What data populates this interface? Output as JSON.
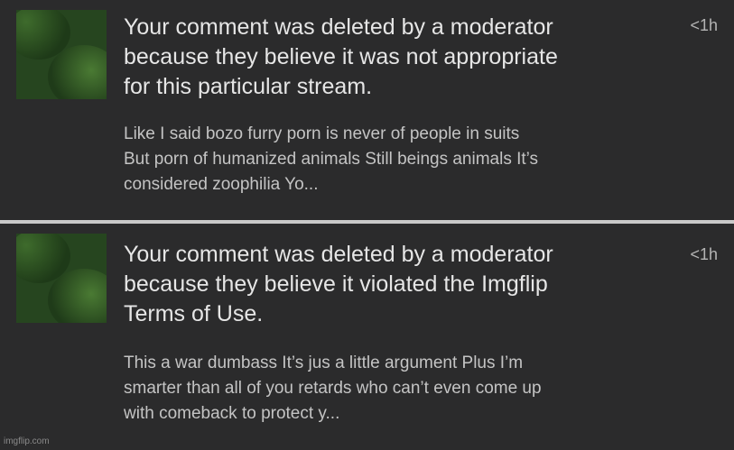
{
  "notifications": [
    {
      "headline_lines": [
        "Your comment was deleted by a moderator",
        "because they believe it was not appropriate",
        "for this particular stream."
      ],
      "time": "<1h",
      "comment_lines": [
        "Like I said bozo furry porn is never of people in suits",
        "But porn of humanized animals Still beings animals It’s",
        "considered zoophilia Yo..."
      ]
    },
    {
      "headline_lines": [
        "Your comment was deleted by a moderator",
        "because they believe it violated the Imgflip",
        "Terms of Use."
      ],
      "time": "<1h",
      "comment_lines": [
        "This a war dumbass It’s jus a little argument Plus I’m",
        "smarter than all of you retards who can’t even come up",
        "with comeback to protect y..."
      ]
    }
  ],
  "watermark": "imgflip.com",
  "colors": {
    "background": "#2b2b2c",
    "divider": "#c9c9c9",
    "headline": "#e6e6e6",
    "body": "#c4c4c4",
    "time": "#b4b4b4",
    "thumbnail_green": "#26451f"
  },
  "icons": {
    "thumbnail": "meme-thumbnail-image"
  }
}
